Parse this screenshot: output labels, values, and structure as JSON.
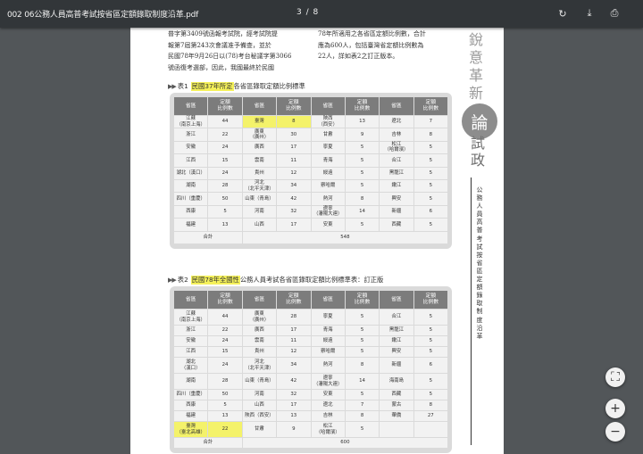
{
  "toolbar": {
    "title": "002 06公務人員高普考試按省區定額錄取制度沿革.pdf",
    "page_indicator": "3 / 8",
    "rotate_icon": "↻",
    "download_icon": "⤓",
    "print_icon": "⎙"
  },
  "page": {
    "left_para": [
      "普字第3409號函報考試院，經考試院提",
      "報第7屆第243次會議准予備查，並於",
      "民國78年9月26日以(78)考台秘議字第3066",
      "號函復考選部，因此，我國最終於民國"
    ],
    "right_para": [
      "78年所適用之各省區定額比例數，合計",
      "應為600人，包括臺灣省定額比例數為",
      "22人，詳如表2之訂正版本。"
    ],
    "table1": {
      "arrows": "▶▶",
      "label": "表1",
      "title_highlight": "民國37年所定",
      "title_rest": "各省區錄取定額比例標準",
      "headers": [
        "省區",
        "定額\n比例數",
        "省區",
        "定額\n比例數",
        "省區",
        "定額\n比例數",
        "省區",
        "定額\n比例數"
      ],
      "rows": [
        [
          "江蘇\n（南京上海）",
          "44",
          "臺灣",
          "8",
          "陝西\n（西安）",
          "13",
          "遼北",
          "7"
        ],
        [
          "浙江",
          "22",
          "廣東\n（廣州）",
          "30",
          "甘肅",
          "9",
          "吉林",
          "8"
        ],
        [
          "安徽",
          "24",
          "廣西",
          "17",
          "寧夏",
          "5",
          "松江\n（哈爾濱）",
          "5"
        ],
        [
          "江西",
          "15",
          "雲南",
          "11",
          "青海",
          "5",
          "合江",
          "5"
        ],
        [
          "湖北（漢口）",
          "24",
          "貴州",
          "12",
          "綏遠",
          "5",
          "黑龍江",
          "5"
        ],
        [
          "湖南",
          "28",
          "河北\n（北平天津）",
          "34",
          "察哈爾",
          "5",
          "嫩江",
          "5"
        ],
        [
          "四川（重慶）",
          "50",
          "山東（青島）",
          "42",
          "熱河",
          "8",
          "興安",
          "5"
        ],
        [
          "西康",
          "5",
          "河南",
          "32",
          "遼寧\n（瀋陽大連）",
          "14",
          "新疆",
          "6"
        ],
        [
          "福建",
          "13",
          "山西",
          "17",
          "安東",
          "5",
          "西藏",
          "5"
        ]
      ],
      "total_label": "合計",
      "total_value": "548"
    },
    "table2": {
      "arrows": "▶▶",
      "label": "表2",
      "title_highlight": "民國78年全國性",
      "title_rest": "公務人員考試各省區錄取定額比例標準表：訂正版",
      "headers": [
        "省區",
        "定額\n比例數",
        "省區",
        "定額\n比例數",
        "省區",
        "定額\n比例數",
        "省區",
        "定額\n比例數"
      ],
      "rows": [
        [
          "江蘇\n（南京上海）",
          "44",
          "廣東\n（廣州）",
          "28",
          "寧夏",
          "5",
          "合江",
          "5"
        ],
        [
          "浙江",
          "22",
          "廣西",
          "17",
          "青海",
          "5",
          "黑龍江",
          "5"
        ],
        [
          "安徽",
          "24",
          "雲南",
          "11",
          "綏遠",
          "5",
          "嫩江",
          "5"
        ],
        [
          "江西",
          "15",
          "貴州",
          "12",
          "察哈爾",
          "5",
          "興安",
          "5"
        ],
        [
          "湖北\n（漢口）",
          "24",
          "河北\n（北平天津）",
          "34",
          "熱河",
          "8",
          "新疆",
          "6"
        ],
        [
          "湖南",
          "28",
          "山東（青島）",
          "42",
          "遼寧\n（瀋陽大連）",
          "14",
          "海南島",
          "5"
        ],
        [
          "四川（重慶）",
          "50",
          "河南",
          "32",
          "安東",
          "5",
          "西藏",
          "5"
        ],
        [
          "西康",
          "5",
          "山西",
          "17",
          "遼北",
          "7",
          "蒙古",
          "8"
        ],
        [
          "福建",
          "13",
          "陝西（西安）",
          "13",
          "吉林",
          "8",
          "華僑",
          "27"
        ],
        [
          "臺灣\n（臺北高雄）",
          "22",
          "甘肅",
          "9",
          "松江\n（哈爾濱）",
          "5",
          "",
          ""
        ]
      ],
      "total_label": "合計",
      "total_value": "600"
    },
    "sidebar": {
      "vertical_top": [
        "銳",
        "意",
        "革",
        "新"
      ],
      "circle_char": "論",
      "vertical_after": [
        "試",
        "政"
      ],
      "subtitle": [
        "公",
        "務",
        "人",
        "員",
        "高",
        "普",
        "考",
        "試",
        "按",
        "省",
        "區",
        "定",
        "額",
        "錄",
        "取",
        "制",
        "度",
        "沿",
        "革"
      ]
    }
  },
  "zoom": {
    "fit_icon": "⛶",
    "zoom_in": "+",
    "zoom_out": "−"
  },
  "colors": {
    "toolbar_bg": "#323639",
    "viewer_bg": "#525659",
    "highlight": "#f5f15a",
    "table_header": "#7c7c7c"
  }
}
